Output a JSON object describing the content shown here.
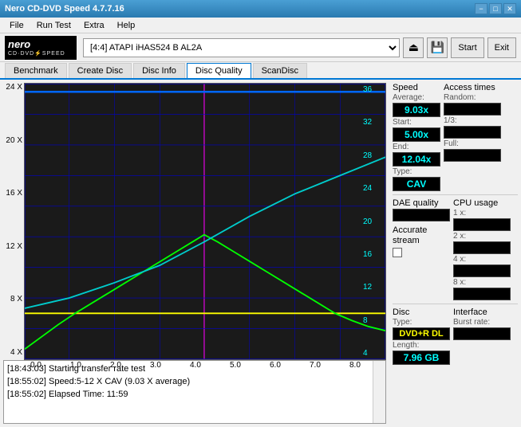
{
  "titleBar": {
    "title": "Nero CD-DVD Speed 4.7.7.16",
    "minBtn": "−",
    "maxBtn": "□",
    "closeBtn": "✕"
  },
  "menuBar": {
    "items": [
      "File",
      "Run Test",
      "Extra",
      "Help"
    ]
  },
  "toolbar": {
    "driveText": "[4:4]  ATAPI  iHAS524  B AL2A",
    "startBtn": "Start",
    "exitBtn": "Exit"
  },
  "tabs": [
    {
      "label": "Benchmark",
      "active": false
    },
    {
      "label": "Create Disc",
      "active": false
    },
    {
      "label": "Disc Info",
      "active": false
    },
    {
      "label": "Disc Quality",
      "active": true
    },
    {
      "label": "ScanDisc",
      "active": false
    }
  ],
  "rightPanel": {
    "speed": {
      "label": "Speed",
      "averageLabel": "Average:",
      "averageValue": "9.03x",
      "startLabel": "Start:",
      "startValue": "5.00x",
      "endLabel": "End:",
      "endValue": "12.04x",
      "typeLabel": "Type:",
      "typeValue": "CAV"
    },
    "accessTimes": {
      "label": "Access times",
      "randomLabel": "Random:",
      "randomValue": "",
      "oneThirdLabel": "1/3:",
      "oneThirdValue": "",
      "fullLabel": "Full:",
      "fullValue": ""
    },
    "cpuUsage": {
      "label": "CPU usage",
      "1x": "1 x:",
      "2x": "2 x:",
      "4x": "4 x:",
      "8x": "8 x:",
      "values": [
        "",
        "",
        "",
        ""
      ]
    },
    "daeQuality": {
      "label": "DAE quality",
      "value": ""
    },
    "accurateStream": {
      "label": "Accurate",
      "label2": "stream",
      "checked": false
    },
    "disc": {
      "label": "Disc",
      "typeLabel": "Type:",
      "typeValue": "DVD+R DL",
      "lengthLabel": "Length:",
      "lengthValue": "7.96 GB"
    },
    "interface": {
      "label": "Interface",
      "burstLabel": "Burst rate:",
      "burstValue": ""
    }
  },
  "chart": {
    "xLabels": [
      "0.0",
      "1.0",
      "2.0",
      "3.0",
      "4.0",
      "5.0",
      "6.0",
      "7.0",
      "8.0"
    ],
    "yLabelsLeft": [
      "24 X",
      "20 X",
      "16 X",
      "12 X",
      "8 X",
      "4 X"
    ],
    "yLabelsRight": [
      "36",
      "32",
      "28",
      "24",
      "20",
      "16",
      "12",
      "8",
      "4"
    ]
  },
  "log": {
    "entries": [
      "[18:43:03]  Starting transfer rate test",
      "[18:55:02]  Speed:5-12 X CAV (9.03 X average)",
      "[18:55:02]  Elapsed Time: 11:59"
    ]
  }
}
